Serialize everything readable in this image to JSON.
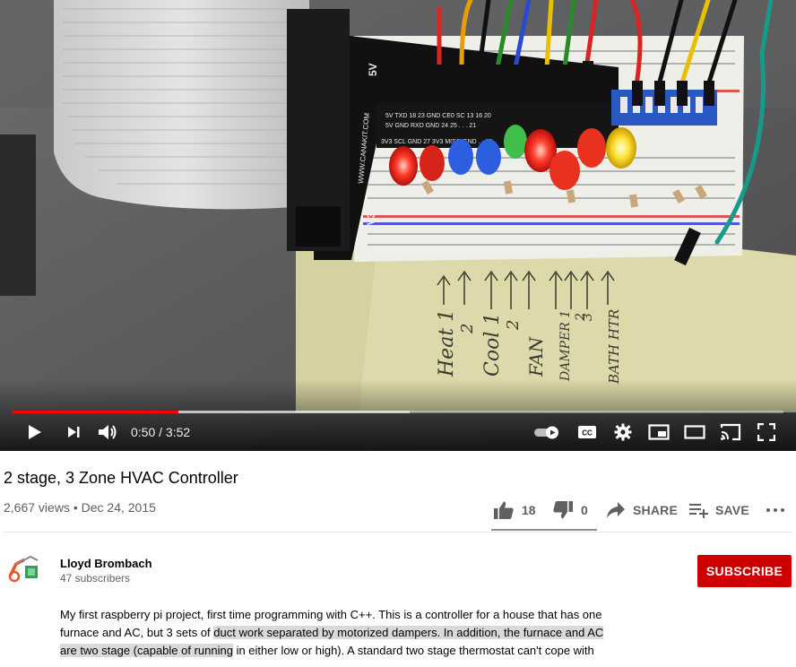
{
  "player": {
    "current_time": "0:50",
    "duration": "3:52",
    "time_separator": " / ",
    "played_fraction": 0.2156,
    "loaded_fraction": 0.515,
    "cc_label": "CC"
  },
  "video_paper": {
    "labels": [
      "Heat 1",
      "2",
      "Cool 1",
      "2",
      "FAN",
      "DAMPER 1",
      "2",
      "3",
      "BATH HTR"
    ]
  },
  "breakout_board": {
    "brand": "WWW.CANAKIT.COM",
    "top_label": "5V",
    "bottom_label": "3V3",
    "pins_row1": [
      "5V",
      "TXD",
      "18",
      "23",
      "GND",
      "CE0",
      "SC",
      "13",
      "16",
      "20"
    ],
    "pins_row2": [
      "5V",
      "GND",
      "RXD",
      "GND",
      "24",
      "25",
      "",
      "",
      "",
      "21"
    ],
    "pins_row3": [
      "3V3",
      "SCL",
      "GND",
      "27",
      "3V3",
      "MISO",
      "GND",
      "",
      "",
      "26"
    ]
  },
  "video": {
    "title": "2 stage, 3 Zone HVAC Controller",
    "views": "2,667 views",
    "separator": " • ",
    "date": "Dec 24, 2015"
  },
  "actions": {
    "likes": "18",
    "dislikes": "0",
    "share_label": "SHARE",
    "save_label": "SAVE"
  },
  "channel": {
    "name": "Lloyd Brombach",
    "subscribers": "47 subscribers",
    "subscribe_label": "SUBSCRIBE",
    "avatar_caption": "LloydBrombach"
  },
  "description": {
    "line1": "My first raspberry pi project, first time programming with C++.  This is a controller for a house that has one",
    "line2a": "furnace and AC, but 3 sets of ",
    "line2b": "duct work separated by motorized dampers. In addition, the furnace and AC",
    "line3a": "are two stage (capable of running",
    "line3b": " in either low or high).  A standard two stage thermostat can't cope with"
  },
  "colors": {
    "accent_red": "#ff0000",
    "subscribe_bg": "#cc0000",
    "text_primary": "#030303",
    "text_secondary": "#606060"
  }
}
